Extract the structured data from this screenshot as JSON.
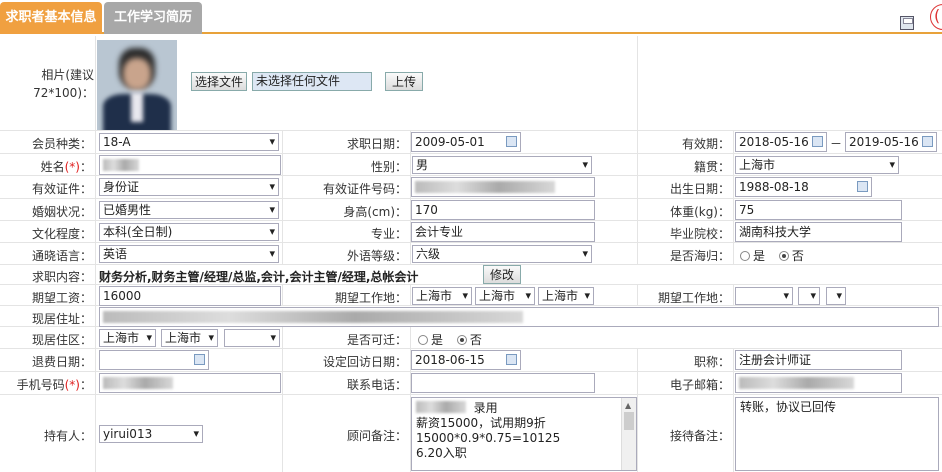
{
  "tabs": [
    {
      "label": "求职者基本信息"
    },
    {
      "label": "工作学习简历"
    }
  ],
  "photo": {
    "label": "相片(建议72*100)：",
    "choose_file": "选择文件",
    "no_file": "未选择任何文件",
    "upload": "上传"
  },
  "fields": {
    "member_type": {
      "label": "会员种类：",
      "value": "18-A"
    },
    "job_date": {
      "label": "求职日期：",
      "value": "2009-05-01"
    },
    "valid_period": {
      "label": "有效期：",
      "from": "2018-05-16",
      "sep": "－",
      "to": "2019-05-16"
    },
    "name": {
      "label": "姓名",
      "req": "(*)",
      "colon": "："
    },
    "gender": {
      "label": "性别：",
      "value": "男"
    },
    "native_place": {
      "label": "籍贯：",
      "value": "上海市"
    },
    "id_type": {
      "label": "有效证件：",
      "value": "身份证"
    },
    "id_number": {
      "label": "有效证件号码："
    },
    "birth_date": {
      "label": "出生日期：",
      "value": "1988-08-18"
    },
    "marital": {
      "label": "婚姻状况：",
      "value": "已婚男性"
    },
    "height": {
      "label": "身高(cm)：",
      "value": "170"
    },
    "weight": {
      "label": "体重(kg)：",
      "value": "75"
    },
    "education": {
      "label": "文化程度：",
      "value": "本科(全日制)"
    },
    "major": {
      "label": "专业：",
      "value": "会计专业"
    },
    "school": {
      "label": "毕业院校：",
      "value": "湖南科技大学"
    },
    "language": {
      "label": "通晓语言：",
      "value": "英语"
    },
    "foreign_level": {
      "label": "外语等级：",
      "value": "六级"
    },
    "returnee": {
      "label": "是否海归：",
      "yes": "是",
      "no": "否"
    },
    "job_content": {
      "label": "求职内容：",
      "value": "财务分析,财务主管/经理/总监,会计,会计主管/经理,总帐会计",
      "edit": "修改"
    },
    "expected_salary": {
      "label": "期望工资：",
      "value": "16000"
    },
    "expected_location": {
      "label": "期望工作地：",
      "v1": "上海市",
      "v2": "上海市",
      "v3": "上海市"
    },
    "expected_location2": {
      "label": "期望工作地："
    },
    "current_address": {
      "label": "现居住址："
    },
    "current_district": {
      "label": "现居住区：",
      "v1": "上海市",
      "v2": "上海市"
    },
    "transfer": {
      "label": "是否可迁：",
      "yes": "是",
      "no": "否"
    },
    "refund_date": {
      "label": "退费日期："
    },
    "visit_date": {
      "label": "设定回访日期：",
      "value": "2018-06-15"
    },
    "title": {
      "label": "职称：",
      "value": "注册会计师证"
    },
    "mobile": {
      "label": "手机号码",
      "req": "(*)",
      "colon": "："
    },
    "phone": {
      "label": "联系电话："
    },
    "email": {
      "label": "电子邮箱："
    },
    "holder": {
      "label": "持有人：",
      "value": "yirui013"
    },
    "advisor_note": {
      "label": "顾问备注：",
      "lines": [
        "录用",
        "薪资15000，试用期9折",
        "15000*0.9*0.75=10125",
        "6.20入职"
      ]
    },
    "reception_note": {
      "label": "接待备注：",
      "value": "转账，协议已回传"
    }
  },
  "colors": {
    "tab_active": "#f0a040",
    "tab_inactive": "#a8a8a8",
    "required": "#e02020"
  }
}
